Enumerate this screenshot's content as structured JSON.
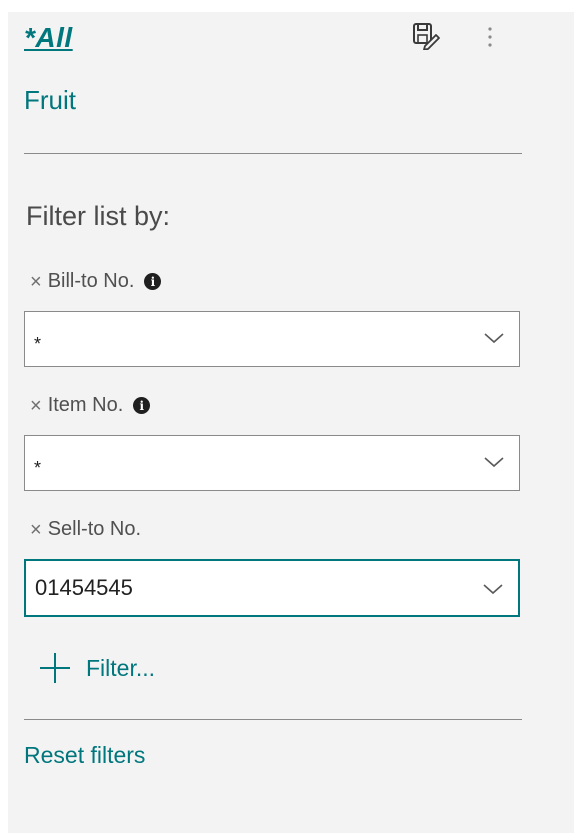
{
  "view": {
    "title": "*All",
    "subtitle": "Fruit"
  },
  "toolbar": {
    "save_icon": "save-view-icon",
    "more_icon": "more-options-icon"
  },
  "filters": {
    "heading": "Filter list by:",
    "fields": [
      {
        "label": "Bill-to No.",
        "value": "*",
        "has_info": true
      },
      {
        "label": "Item No.",
        "value": "*",
        "has_info": true
      },
      {
        "label": "Sell-to No.",
        "value": "01454545",
        "has_info": false,
        "focused": true
      }
    ],
    "remove_symbol": "×",
    "info_symbol": "i"
  },
  "actions": {
    "add_filter_label": "Filter...",
    "reset_label": "Reset filters"
  },
  "colors": {
    "accent": "#00767d",
    "pane_background": "#f3f3f3",
    "field_border": "#8a8a8a"
  }
}
